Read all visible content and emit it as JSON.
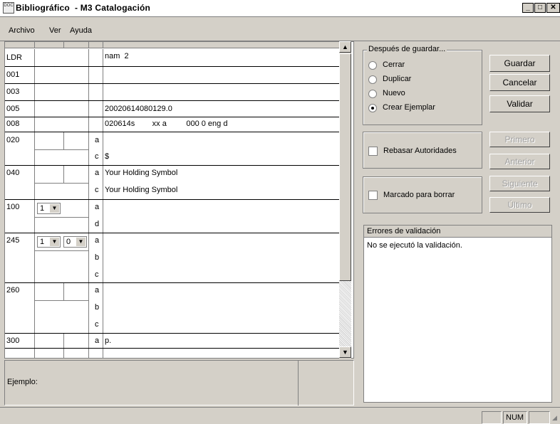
{
  "window": {
    "title": "Bibliográfico  - M3 Catalogación",
    "icon": "doc-icon"
  },
  "menu": [
    "Archivo",
    "Ver",
    "Ayuda"
  ],
  "rows": [
    {
      "tag": "LDR",
      "text": "nam  2"
    },
    {
      "tag": "001",
      "text": ""
    },
    {
      "tag": "003",
      "text": ""
    },
    {
      "tag": "005",
      "text": "20020614080129.0"
    },
    {
      "tag": "008",
      "text": "020614s        xx a         000 0 eng d"
    },
    {
      "tag": "020",
      "subs": [
        {
          "code": "a",
          "text": ""
        },
        {
          "code": "c",
          "text": "$"
        }
      ]
    },
    {
      "tag": "040",
      "subs": [
        {
          "code": "a",
          "text": "Your Holding Symbol"
        },
        {
          "code": "c",
          "text": "Your Holding Symbol"
        }
      ]
    },
    {
      "tag": "100",
      "ind1": "1",
      "subs": [
        {
          "code": "a",
          "text": ""
        },
        {
          "code": "d",
          "text": ""
        }
      ]
    },
    {
      "tag": "245",
      "ind1": "1",
      "ind2": "0",
      "subs": [
        {
          "code": "a",
          "text": ""
        },
        {
          "code": "b",
          "text": ""
        },
        {
          "code": "c",
          "text": ""
        }
      ]
    },
    {
      "tag": "260",
      "subs": [
        {
          "code": "a",
          "text": ""
        },
        {
          "code": "b",
          "text": ""
        },
        {
          "code": "c",
          "text": ""
        }
      ]
    },
    {
      "tag": "300",
      "subs": [
        {
          "code": "a",
          "text": "p."
        }
      ]
    }
  ],
  "example": {
    "label": "Ejemplo:"
  },
  "after_save": {
    "label": "Después de guardar...",
    "options": [
      "Cerrar",
      "Duplicar",
      "Nuevo",
      "Crear Ejemplar"
    ],
    "selected": 3
  },
  "buttons": {
    "save": "Guardar",
    "cancel": "Cancelar",
    "validate": "Validar",
    "first": "Primero",
    "previous": "Anterior",
    "next": "Siguiente",
    "last": "Último"
  },
  "checkboxes": {
    "authorities": "Rebasar Autoridades",
    "delete": "Marcado para borrar"
  },
  "errors": {
    "header": "Errores de validación",
    "message": "No se ejecutó la validación."
  },
  "status": {
    "num": "NUM"
  }
}
